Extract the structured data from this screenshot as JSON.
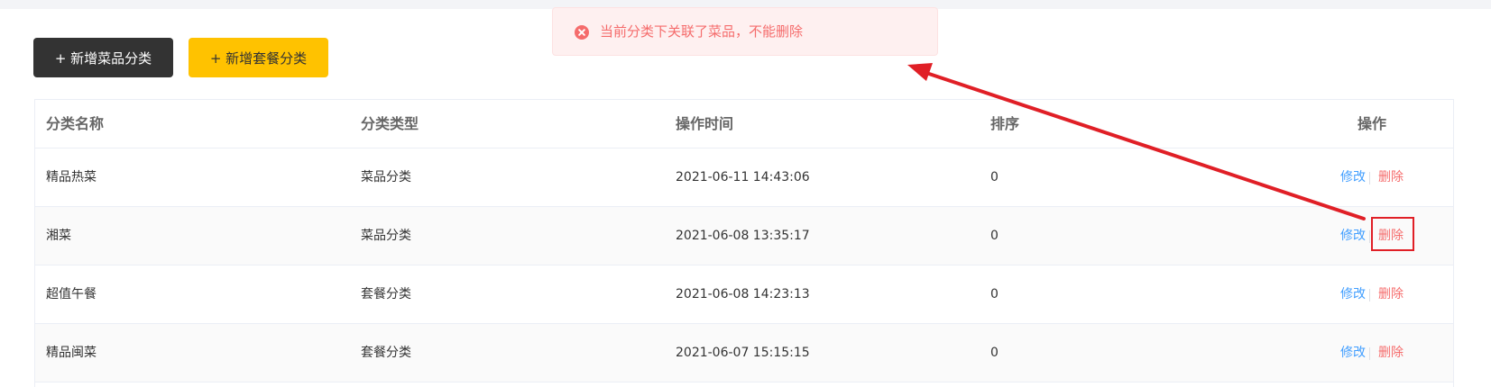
{
  "toolbar": {
    "add_dish_category": "+ 新增菜品分类",
    "add_set_category": "+ 新增套餐分类"
  },
  "table": {
    "headers": [
      "分类名称",
      "分类类型",
      "操作时间",
      "排序",
      "操作"
    ],
    "rows": [
      {
        "name": "精品热菜",
        "type": "菜品分类",
        "time": "2021-06-11 14:43:06",
        "sort": "0",
        "edit": "修改",
        "delete": "删除"
      },
      {
        "name": "湘菜",
        "type": "菜品分类",
        "time": "2021-06-08 13:35:17",
        "sort": "0",
        "edit": "修改",
        "delete": "删除"
      },
      {
        "name": "超值午餐",
        "type": "套餐分类",
        "time": "2021-06-08 14:23:13",
        "sort": "0",
        "edit": "修改",
        "delete": "删除"
      },
      {
        "name": "精品闽菜",
        "type": "套餐分类",
        "time": "2021-06-07 15:15:15",
        "sort": "0",
        "edit": "修改",
        "delete": "删除"
      }
    ]
  },
  "toast": {
    "icon": "error-circle-icon",
    "message": "当前分类下关联了菜品，不能删除"
  },
  "colors": {
    "dark_button": "#333333",
    "yellow_button": "#ffc200",
    "edit_link": "#419eff",
    "delete_link": "#f56c6c",
    "annotation_red": "#e01f26"
  }
}
